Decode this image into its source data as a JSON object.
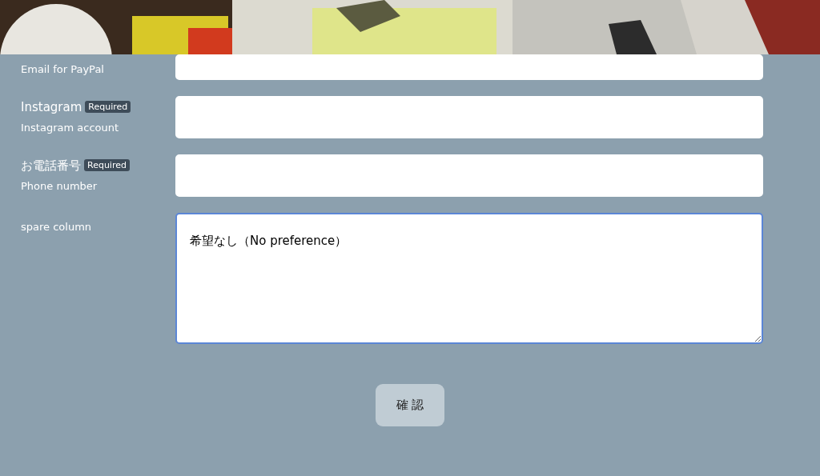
{
  "fields": [
    {
      "kind": "input",
      "label": "Email for PayPal",
      "required": false
    },
    {
      "kind": "input",
      "label": "Instagram",
      "sublabel": "Instagram account",
      "required": true,
      "badge": "Required"
    },
    {
      "kind": "input",
      "label": "お電話番号",
      "sublabel": "Phone number",
      "required": true,
      "badge": "Required"
    },
    {
      "kind": "textarea",
      "label": "spare column",
      "value": "希望なし（No preference）",
      "focused": true
    }
  ],
  "submit_button": {
    "label": "確 認"
  }
}
